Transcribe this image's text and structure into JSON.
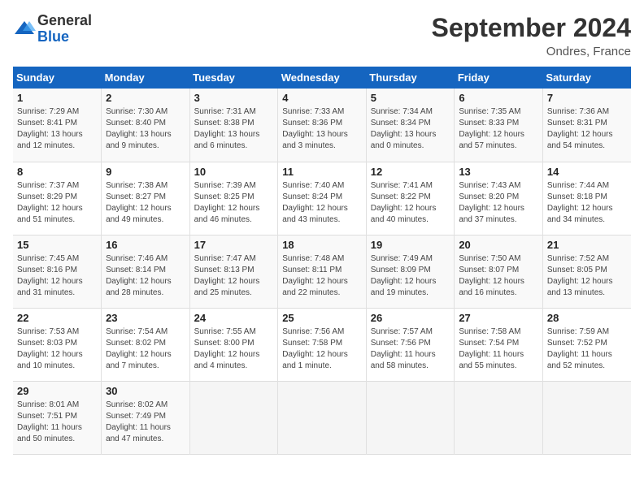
{
  "app": {
    "logo_line1": "General",
    "logo_line2": "Blue"
  },
  "header": {
    "title": "September 2024",
    "location": "Ondres, France"
  },
  "weekdays": [
    "Sunday",
    "Monday",
    "Tuesday",
    "Wednesday",
    "Thursday",
    "Friday",
    "Saturday"
  ],
  "weeks": [
    [
      {
        "num": "1",
        "sunrise": "7:29 AM",
        "sunset": "8:41 PM",
        "daylight": "13 hours and 12 minutes."
      },
      {
        "num": "2",
        "sunrise": "7:30 AM",
        "sunset": "8:40 PM",
        "daylight": "13 hours and 9 minutes."
      },
      {
        "num": "3",
        "sunrise": "7:31 AM",
        "sunset": "8:38 PM",
        "daylight": "13 hours and 6 minutes."
      },
      {
        "num": "4",
        "sunrise": "7:33 AM",
        "sunset": "8:36 PM",
        "daylight": "13 hours and 3 minutes."
      },
      {
        "num": "5",
        "sunrise": "7:34 AM",
        "sunset": "8:34 PM",
        "daylight": "13 hours and 0 minutes."
      },
      {
        "num": "6",
        "sunrise": "7:35 AM",
        "sunset": "8:33 PM",
        "daylight": "12 hours and 57 minutes."
      },
      {
        "num": "7",
        "sunrise": "7:36 AM",
        "sunset": "8:31 PM",
        "daylight": "12 hours and 54 minutes."
      }
    ],
    [
      {
        "num": "8",
        "sunrise": "7:37 AM",
        "sunset": "8:29 PM",
        "daylight": "12 hours and 51 minutes."
      },
      {
        "num": "9",
        "sunrise": "7:38 AM",
        "sunset": "8:27 PM",
        "daylight": "12 hours and 49 minutes."
      },
      {
        "num": "10",
        "sunrise": "7:39 AM",
        "sunset": "8:25 PM",
        "daylight": "12 hours and 46 minutes."
      },
      {
        "num": "11",
        "sunrise": "7:40 AM",
        "sunset": "8:24 PM",
        "daylight": "12 hours and 43 minutes."
      },
      {
        "num": "12",
        "sunrise": "7:41 AM",
        "sunset": "8:22 PM",
        "daylight": "12 hours and 40 minutes."
      },
      {
        "num": "13",
        "sunrise": "7:43 AM",
        "sunset": "8:20 PM",
        "daylight": "12 hours and 37 minutes."
      },
      {
        "num": "14",
        "sunrise": "7:44 AM",
        "sunset": "8:18 PM",
        "daylight": "12 hours and 34 minutes."
      }
    ],
    [
      {
        "num": "15",
        "sunrise": "7:45 AM",
        "sunset": "8:16 PM",
        "daylight": "12 hours and 31 minutes."
      },
      {
        "num": "16",
        "sunrise": "7:46 AM",
        "sunset": "8:14 PM",
        "daylight": "12 hours and 28 minutes."
      },
      {
        "num": "17",
        "sunrise": "7:47 AM",
        "sunset": "8:13 PM",
        "daylight": "12 hours and 25 minutes."
      },
      {
        "num": "18",
        "sunrise": "7:48 AM",
        "sunset": "8:11 PM",
        "daylight": "12 hours and 22 minutes."
      },
      {
        "num": "19",
        "sunrise": "7:49 AM",
        "sunset": "8:09 PM",
        "daylight": "12 hours and 19 minutes."
      },
      {
        "num": "20",
        "sunrise": "7:50 AM",
        "sunset": "8:07 PM",
        "daylight": "12 hours and 16 minutes."
      },
      {
        "num": "21",
        "sunrise": "7:52 AM",
        "sunset": "8:05 PM",
        "daylight": "12 hours and 13 minutes."
      }
    ],
    [
      {
        "num": "22",
        "sunrise": "7:53 AM",
        "sunset": "8:03 PM",
        "daylight": "12 hours and 10 minutes."
      },
      {
        "num": "23",
        "sunrise": "7:54 AM",
        "sunset": "8:02 PM",
        "daylight": "12 hours and 7 minutes."
      },
      {
        "num": "24",
        "sunrise": "7:55 AM",
        "sunset": "8:00 PM",
        "daylight": "12 hours and 4 minutes."
      },
      {
        "num": "25",
        "sunrise": "7:56 AM",
        "sunset": "7:58 PM",
        "daylight": "12 hours and 1 minute."
      },
      {
        "num": "26",
        "sunrise": "7:57 AM",
        "sunset": "7:56 PM",
        "daylight": "11 hours and 58 minutes."
      },
      {
        "num": "27",
        "sunrise": "7:58 AM",
        "sunset": "7:54 PM",
        "daylight": "11 hours and 55 minutes."
      },
      {
        "num": "28",
        "sunrise": "7:59 AM",
        "sunset": "7:52 PM",
        "daylight": "11 hours and 52 minutes."
      }
    ],
    [
      {
        "num": "29",
        "sunrise": "8:01 AM",
        "sunset": "7:51 PM",
        "daylight": "11 hours and 50 minutes."
      },
      {
        "num": "30",
        "sunrise": "8:02 AM",
        "sunset": "7:49 PM",
        "daylight": "11 hours and 47 minutes."
      },
      null,
      null,
      null,
      null,
      null
    ]
  ]
}
